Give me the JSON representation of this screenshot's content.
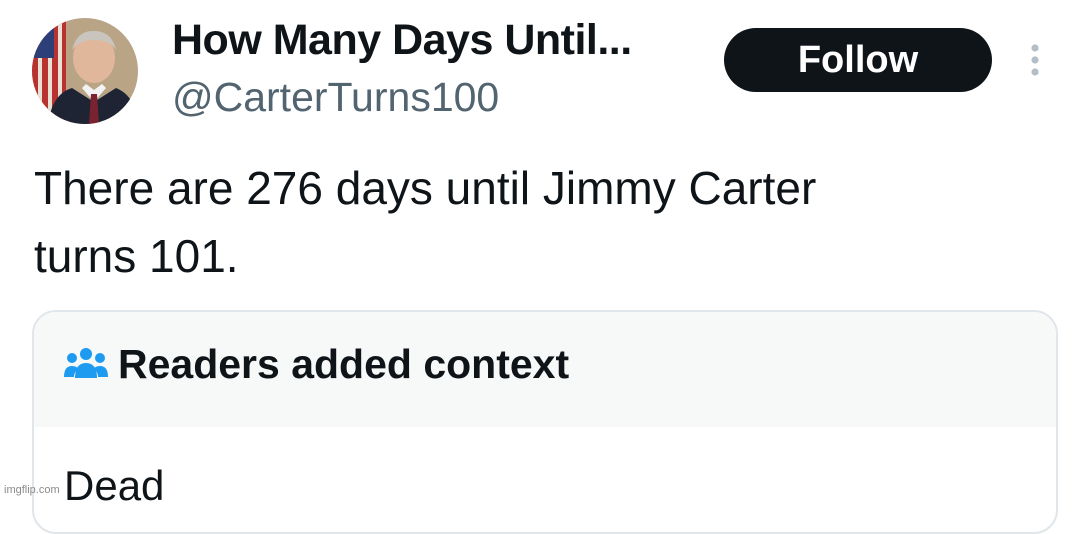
{
  "author": {
    "name": "How Many Days Until...",
    "handle": "@CarterTurns100",
    "avatar_icon": "portrait-avatar"
  },
  "follow_button": {
    "label": "Follow"
  },
  "more_icon": "vertical-ellipsis-icon",
  "tweet": {
    "text": "There are 276 days until Jimmy Carter\nturns 101."
  },
  "context_note": {
    "icon": "readers-group-icon",
    "title": "Readers added context",
    "body": "Dead"
  },
  "watermark": "imgflip.com",
  "colors": {
    "text": "#0f1419",
    "secondary_text": "#536471",
    "follow_bg": "#0f1419",
    "accent_blue": "#1d9bf0",
    "card_border": "#e1e6ea",
    "card_header_bg": "#f7f9f9"
  }
}
